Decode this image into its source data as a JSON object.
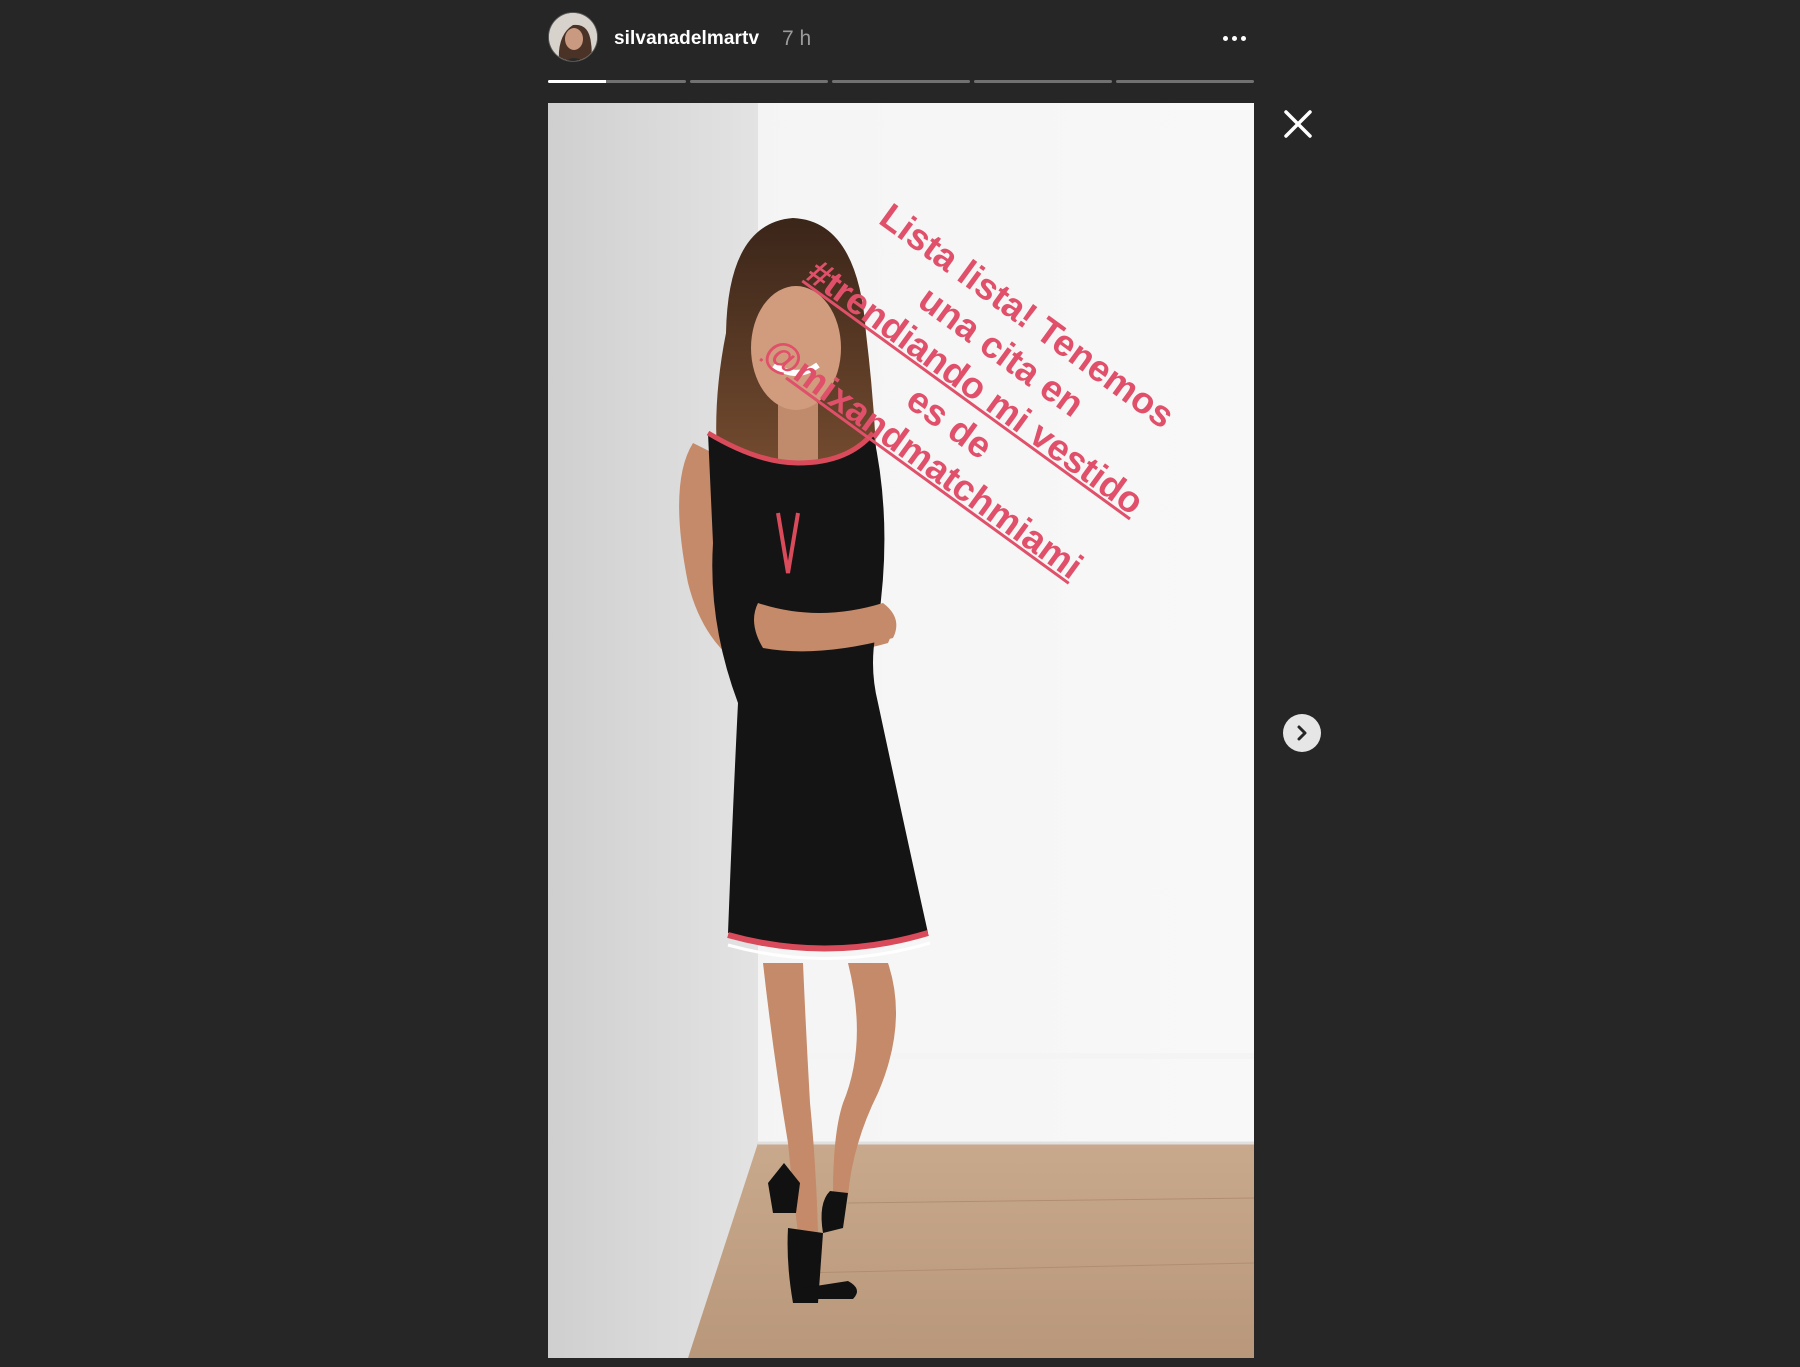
{
  "header": {
    "username": "silvanadelmartv",
    "time": "7 h",
    "more_icon": "more-horizontal-icon"
  },
  "progress": {
    "segments": 5,
    "active_index": 0,
    "active_fraction": 0.42
  },
  "story": {
    "caption_lines": [
      "Lista lista! Tenemos",
      "una cita en",
      "#trendiando mi vestido",
      "es de",
      "@mixandmatchmiami"
    ],
    "caption_color": "#e0506a"
  },
  "controls": {
    "close_icon": "close-icon",
    "next_icon": "chevron-right-icon"
  }
}
